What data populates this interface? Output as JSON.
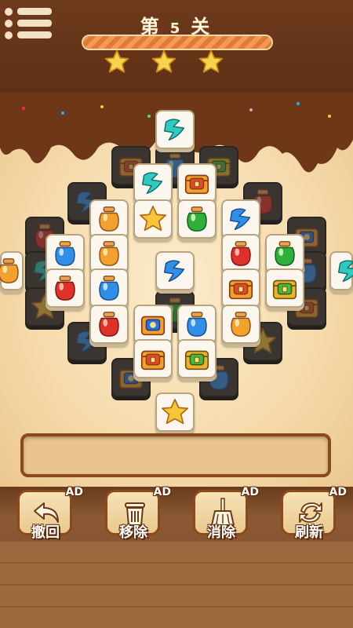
{
  "header": {
    "level_prefix": "第",
    "level_number": "5",
    "level_suffix": "关",
    "progress": 1.0,
    "stars_earned": 3
  },
  "colors": {
    "wood_dark": "#5a2c14",
    "cream": "#f6dcae",
    "tile_face": "#fbf6ee",
    "tile_covered": "#3a3530",
    "progress_orange": "#f39a54",
    "star_yellow": "#f7d44a"
  },
  "board": {
    "tiles_top_layer": [
      "lightning-blue",
      "lightning-blue",
      "treasure-chest",
      "jar-orange",
      "star",
      "jar-green",
      "gem-blue",
      "jar-blue",
      "jar-orange",
      "jar-red",
      "jar-green",
      "jar-red",
      "jar-blue",
      "lightning-blue",
      "treasure-chest",
      "treasure-chest",
      "jar-orange",
      "jar-red",
      "ring-chest",
      "jar-blue",
      "jar-orange",
      "treasure-chest",
      "treasure-chest",
      "star",
      "jar-orange",
      "lightning-teal"
    ]
  },
  "tray": {
    "capacity_slots": 7,
    "filled": 0
  },
  "tools": [
    {
      "id": "undo",
      "label": "撤回",
      "badge": "AD",
      "icon": "undo-arrow-icon"
    },
    {
      "id": "remove",
      "label": "移除",
      "badge": "AD",
      "icon": "trash-icon"
    },
    {
      "id": "clear",
      "label": "消除",
      "badge": "AD",
      "icon": "broom-icon"
    },
    {
      "id": "refresh",
      "label": "刷新",
      "badge": "AD",
      "icon": "refresh-icon"
    }
  ]
}
